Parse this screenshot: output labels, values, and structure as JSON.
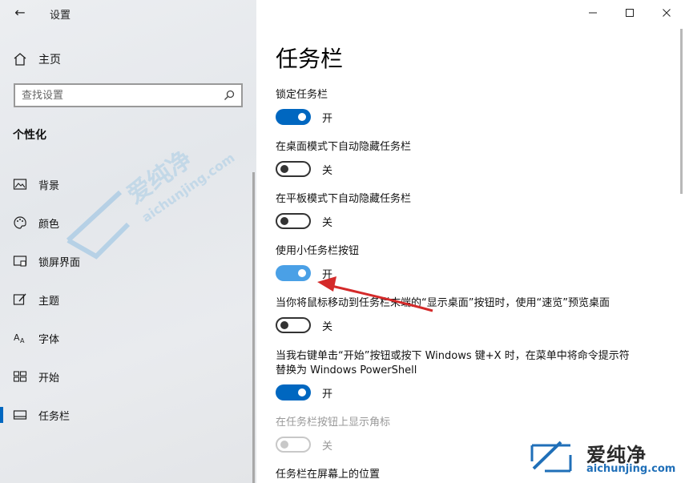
{
  "app": {
    "title": "设置"
  },
  "sidebar": {
    "home_label": "主页",
    "search_placeholder": "查找设置",
    "section_title": "个性化",
    "items": [
      {
        "label": "背景",
        "icon": "image-icon"
      },
      {
        "label": "颜色",
        "icon": "palette-icon"
      },
      {
        "label": "锁屏界面",
        "icon": "lock-screen-icon"
      },
      {
        "label": "主题",
        "icon": "theme-brush-icon"
      },
      {
        "label": "字体",
        "icon": "font-icon"
      },
      {
        "label": "开始",
        "icon": "start-grid-icon"
      },
      {
        "label": "任务栏",
        "icon": "taskbar-icon",
        "active": true
      }
    ]
  },
  "main": {
    "title": "任务栏",
    "settings": [
      {
        "label": "锁定任务栏",
        "state": "开",
        "on": true
      },
      {
        "label": "在桌面模式下自动隐藏任务栏",
        "state": "关",
        "on": false
      },
      {
        "label": "在平板模式下自动隐藏任务栏",
        "state": "关",
        "on": false
      },
      {
        "label": "使用小任务栏按钮",
        "state": "开",
        "on": true
      },
      {
        "label": "当你将鼠标移动到任务栏末端的“显示桌面”按钮时，使用“速览”预览桌面",
        "state": "关",
        "on": false
      },
      {
        "label": "当我右键单击“开始”按钮或按下 Windows 键+X 时，在菜单中将命令提示符替换为 Windows PowerShell",
        "state": "开",
        "on": true
      },
      {
        "label": "在任务栏按钮上显示角标",
        "state": "关",
        "on": false,
        "disabled": true
      },
      {
        "label": "任务栏在屏幕上的位置"
      }
    ]
  },
  "watermark": {
    "brand": "爱纯净",
    "url": "aichunjing.com",
    "diag_brand": "爱纯净",
    "diag_url": "aichunjing.com"
  },
  "colors": {
    "accent": "#0067c0",
    "annotation_arrow": "#d42a2a"
  }
}
